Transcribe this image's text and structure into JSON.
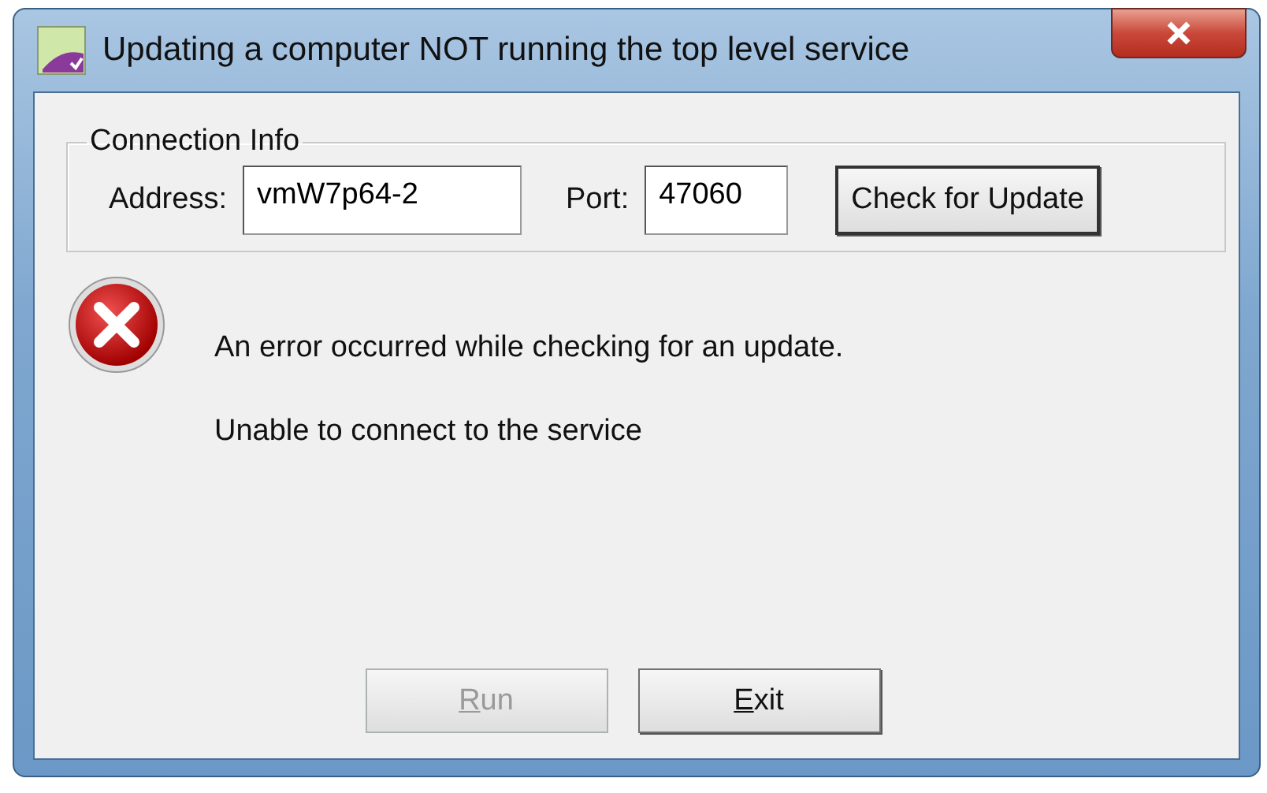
{
  "window": {
    "title": "Updating a computer NOT running the top level service"
  },
  "connection_info": {
    "title": "Connection Info",
    "address_label": "Address:",
    "address": "vmW7p64-2",
    "port_label": "Port:",
    "port": "47060",
    "button": "Check for Update"
  },
  "message": {
    "kind": "error",
    "lines": [
      "An error occurred while checking for an update.",
      "Unable to connect to the service"
    ]
  },
  "buttons": [
    {
      "label": "Run",
      "disabled": true
    },
    {
      "label": "Exit",
      "disabled": false
    }
  ]
}
